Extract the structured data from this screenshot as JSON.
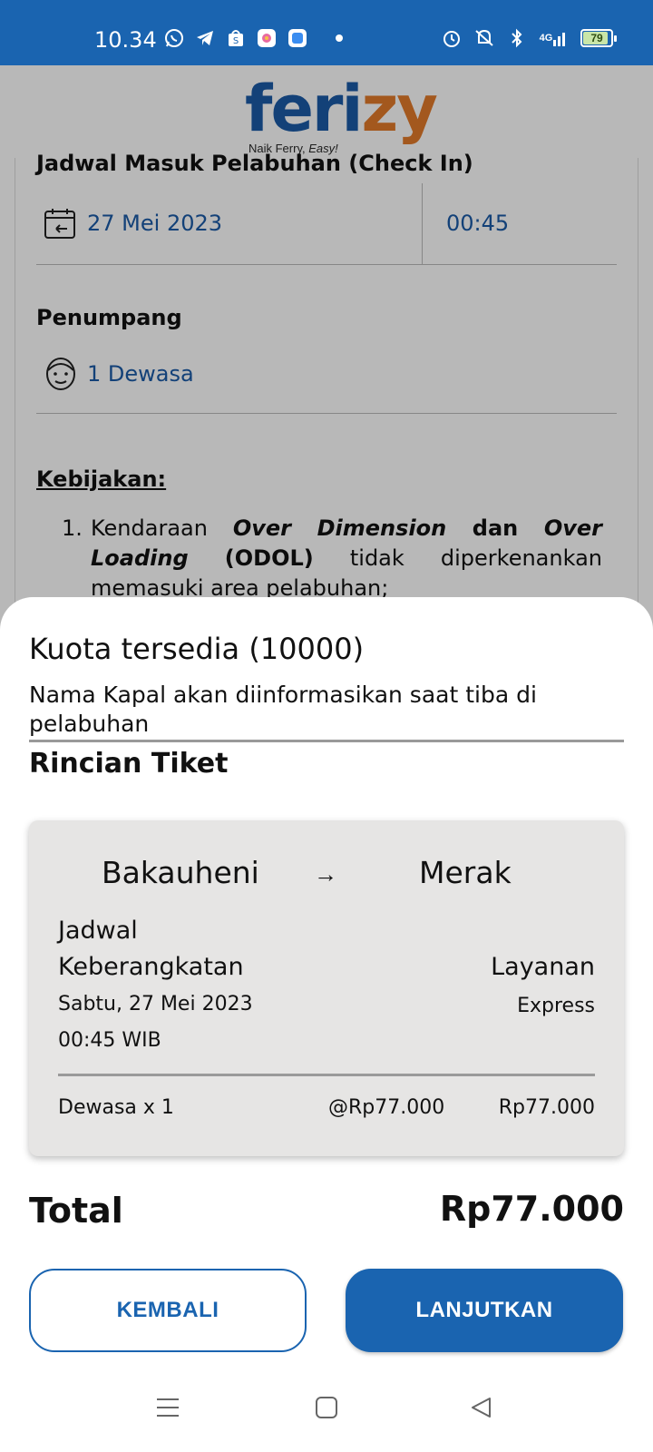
{
  "status_bar": {
    "time": "10.34",
    "network": "4G",
    "battery": "79"
  },
  "header": {
    "logo_main_1": "feri",
    "logo_main_2": "zy",
    "logo_tag_1": "Naik Ferry, ",
    "logo_tag_2": "Easy!"
  },
  "background": {
    "checkin_heading": "Jadwal Masuk Pelabuhan (Check In)",
    "checkin_date": "27 Mei 2023",
    "checkin_time": "00:45",
    "passenger_title": "Penumpang",
    "passenger_value": "1 Dewasa",
    "policy_title": "Kebijakan:",
    "policy_number": "1.",
    "policy_text_parts": [
      "Kendaraan ",
      "Over Dimension",
      " dan ",
      "Over Loading",
      " ",
      "(ODOL)",
      " tidak diperkenankan memasuki area pelabuhan;"
    ]
  },
  "sheet": {
    "quota": "Kuota tersedia (10000)",
    "ship_info": "Nama Kapal akan diinformasikan saat tiba di pelabuhan",
    "section_title": "Rincian Tiket",
    "ticket": {
      "origin": "Bakauheni",
      "arrow": "→",
      "destination": "Merak",
      "schedule_label": "Jadwal Keberangkatan",
      "service_label": "Layanan",
      "departure_date": "Sabtu, 27 Mei 2023",
      "departure_time": "00:45 WIB",
      "service_value": "Express",
      "fare_passenger": "Dewasa x 1",
      "fare_unit": "@Rp77.000",
      "fare_subtotal": "Rp77.000"
    },
    "total_label": "Total",
    "total_value": "Rp77.000",
    "back_button": "KEMBALI",
    "next_button": "LANJUTKAN"
  },
  "colors": {
    "primary": "#1a64b0",
    "logo_orange": "#e27a2a",
    "card_bg": "#e6e5e4"
  }
}
